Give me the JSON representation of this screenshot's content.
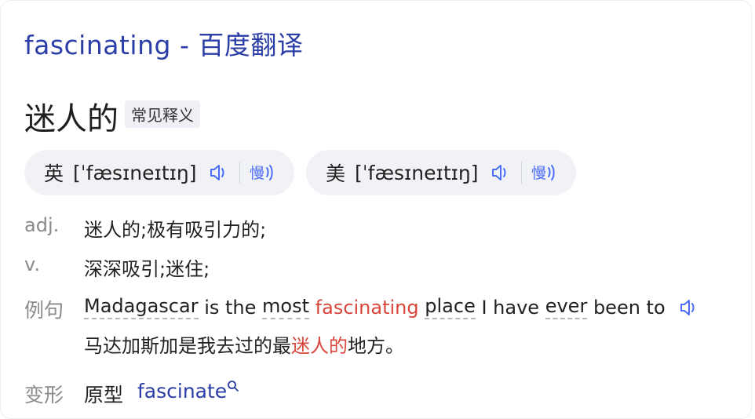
{
  "title": "fascinating - 百度翻译",
  "headword": {
    "meaning": "迷人的",
    "tag": "常见释义"
  },
  "pronunciations": [
    {
      "lang": "英",
      "phonetic": "[ˈfæsɪneɪtɪŋ]"
    },
    {
      "lang": "美",
      "phonetic": "[ˈfæsɪneɪtɪŋ]"
    }
  ],
  "definitions": [
    {
      "pos": "adj.",
      "meaning": "迷人的;极有吸引力的;"
    },
    {
      "pos": "v.",
      "meaning": "深深吸引;迷住;"
    }
  ],
  "example": {
    "label": "例句",
    "en": {
      "w1": "Madagascar",
      "w2": " is the ",
      "w3": "most",
      "w4": " ",
      "w5": "fascinating",
      "w6": " ",
      "w7": "place",
      "w8": " I have ",
      "w9": "ever",
      "w10": " been to"
    },
    "zh_before": "马达加斯加是我去过的最",
    "zh_highlight": "迷人的",
    "zh_after": "地方。"
  },
  "variants": {
    "label": "变形",
    "kind": "原型",
    "word": "fascinate"
  },
  "colors": {
    "accent": "#2b3ea8",
    "highlight": "#d9463b",
    "icon": "#4a6cf7"
  },
  "icons": {
    "play": "speaker-icon",
    "slow": "slow-play-icon",
    "search": "search-icon"
  }
}
